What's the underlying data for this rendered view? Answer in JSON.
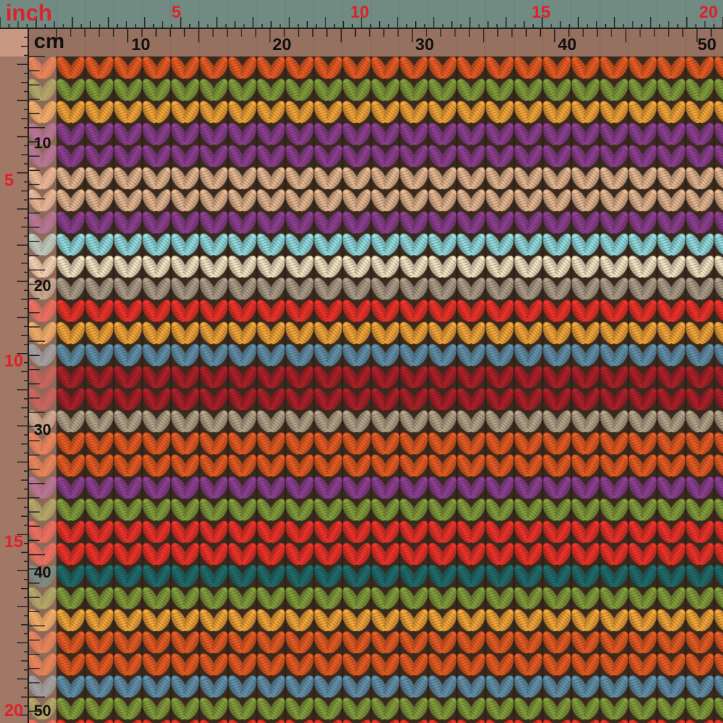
{
  "ruler": {
    "inch_title": "inch",
    "cm_title": "cm",
    "inch_top_labels": [
      "5",
      "10",
      "15",
      "20"
    ],
    "cm_top_labels": [
      "10",
      "20",
      "30",
      "40",
      "50"
    ],
    "inch_left_labels": [
      "5",
      "10",
      "15",
      "20"
    ],
    "cm_left_labels": [
      "10",
      "20",
      "30",
      "40",
      "50"
    ],
    "inch_color": "#e0202a",
    "cm_color": "#111111"
  },
  "fabric": {
    "pattern": "knit-stitch-stripes",
    "background_color": "#3a2a1e",
    "stripe_colors": [
      "#e25a24",
      "#7f9a3c",
      "#f0a23a",
      "#8a3f8f",
      "#8a3f8f",
      "#e0b48f",
      "#e0b48f",
      "#8a3f8f",
      "#8fd8dc",
      "#efe0c0",
      "#a89a86",
      "#e8322a",
      "#f0a23a",
      "#5f8ea8",
      "#a8202a",
      "#a8202a",
      "#b0a088",
      "#e25a24",
      "#e25a24",
      "#8a3f8f",
      "#7f9a3c",
      "#e8322a",
      "#e8322a",
      "#1f6a6a",
      "#7f9a3c",
      "#f0a23a",
      "#e25a24",
      "#e25a24",
      "#5f8ea8",
      "#7f9a3c",
      "#e8322a",
      "#1a8a86"
    ]
  }
}
